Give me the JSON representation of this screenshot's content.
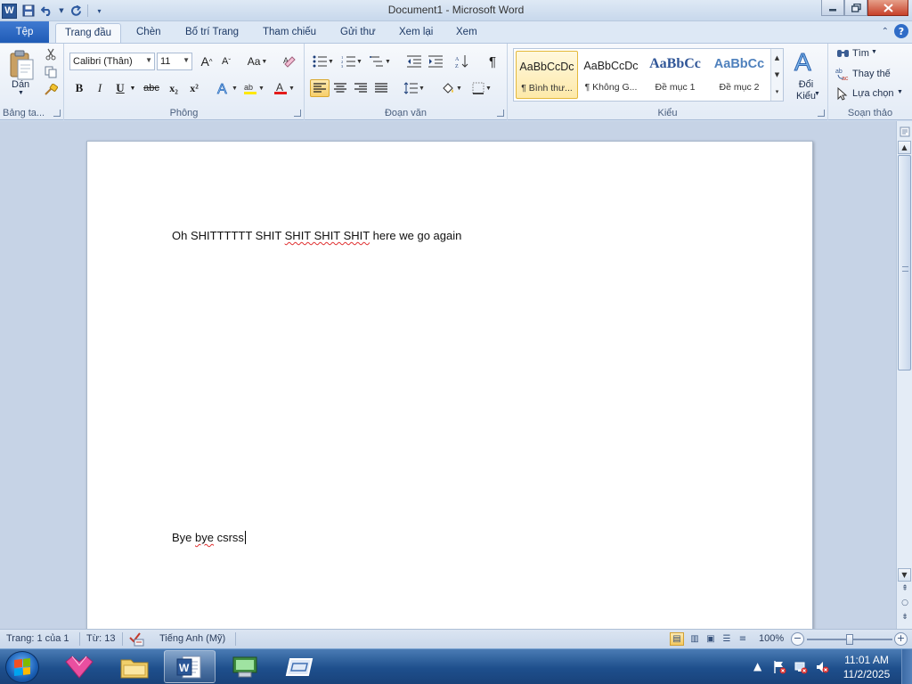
{
  "window": {
    "title": "Document1 - Microsoft Word",
    "app_logo": "W",
    "controls": [
      "minimize",
      "restore",
      "close"
    ]
  },
  "quick_access": {
    "icons": [
      "save-icon",
      "undo-icon",
      "redo-icon",
      "customize-icon"
    ]
  },
  "tabs": [
    {
      "label": "Tệp"
    },
    {
      "label": "Trang đầu"
    },
    {
      "label": "Chèn"
    },
    {
      "label": "Bố trí Trang"
    },
    {
      "label": "Tham chiếu"
    },
    {
      "label": "Gửi thư"
    },
    {
      "label": "Xem lại"
    },
    {
      "label": "Xem"
    }
  ],
  "ribbon": {
    "clipboard": {
      "label": "Bảng ta...",
      "paste": "Dán"
    },
    "font": {
      "label": "Phông",
      "name": "Calibri (Thân)",
      "size": "11",
      "bold": "B",
      "italic": "I",
      "underline": "U",
      "strike": "abc",
      "subscript": "x₂",
      "superscript": "x²",
      "grow": "A",
      "shrink": "A",
      "change_case": "Aa"
    },
    "paragraph": {
      "label": "Đoạn văn",
      "pilcrow": "¶"
    },
    "styles": {
      "label": "Kiểu",
      "items": [
        {
          "sample": "AaBbCcDc",
          "name": "¶ Bình thư...",
          "color": "#000000"
        },
        {
          "sample": "AaBbCcDc",
          "name": "¶ Không G...",
          "color": "#000000"
        },
        {
          "sample": "AaBbCc",
          "name": "Đề mục 1",
          "color": "#2f5597"
        },
        {
          "sample": "AaBbCc",
          "name": "Đề mục 2",
          "color": "#4f81bd"
        }
      ],
      "change": "Đổi Kiểu"
    },
    "editing": {
      "label": "Soạn thảo",
      "find": "Tìm",
      "replace": "Thay thế",
      "select": "Lựa chọn"
    }
  },
  "document": {
    "line1": "Oh SHITTTTTT SHIT SHIT SHIT SHIT here we go again",
    "line1_parts": {
      "a": "Oh SHITTTTTT SHIT ",
      "b": "SHIT SHIT SHIT",
      "c": " here we go again"
    },
    "line2_parts": {
      "a": "Bye ",
      "b": "bye",
      "c": " csrss"
    }
  },
  "status": {
    "page": "Trang: 1 của 1",
    "words": "Từ: 13",
    "language": "Tiếng Anh (Mỹ)",
    "zoom": "100%"
  },
  "taskbar": {
    "clock_time": "11:01 AM",
    "clock_date": "11/2/2025",
    "items": [
      "start-button",
      "pinned-app-pink",
      "file-explorer",
      "microsoft-word",
      "system-app",
      "notes-app"
    ]
  },
  "colors": {
    "accent": "#2b5797",
    "file_tab": "#2a65c0",
    "spell_error": "#e03030",
    "selected_style": "#fde9a9"
  }
}
